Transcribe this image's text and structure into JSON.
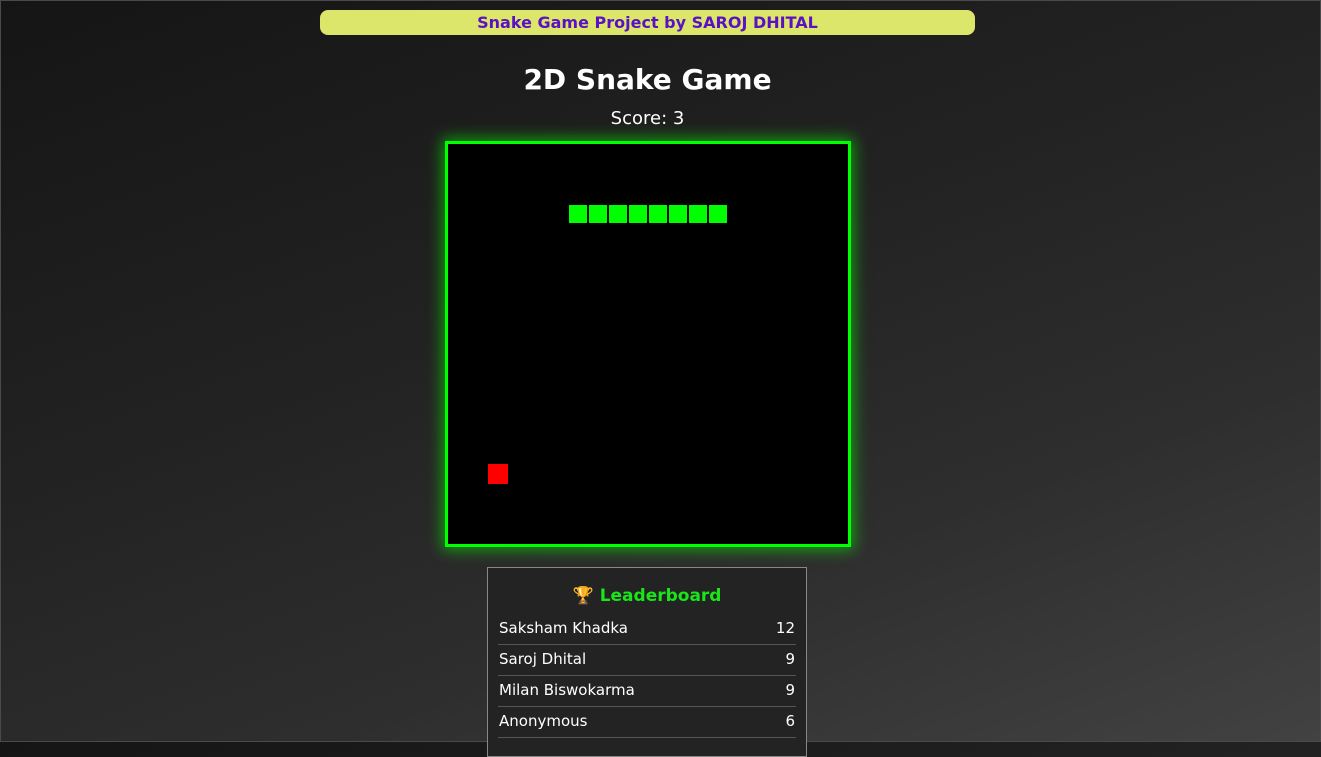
{
  "banner": {
    "text": "Snake Game Project by SAROJ DHITAL"
  },
  "game": {
    "title": "2D Snake Game",
    "score_text": "Score: 3",
    "score": 3,
    "grid": {
      "cols": 20,
      "rows": 20
    },
    "snake": [
      {
        "col": 6,
        "row": 3
      },
      {
        "col": 7,
        "row": 3
      },
      {
        "col": 8,
        "row": 3
      },
      {
        "col": 9,
        "row": 3
      },
      {
        "col": 10,
        "row": 3
      },
      {
        "col": 11,
        "row": 3
      },
      {
        "col": 12,
        "row": 3
      },
      {
        "col": 13,
        "row": 3
      }
    ],
    "food": {
      "col": 2,
      "row": 16
    }
  },
  "leaderboard": {
    "icon": "trophy-icon",
    "title": "Leaderboard",
    "entries": [
      {
        "name": "Saksham Khadka",
        "score": "12"
      },
      {
        "name": "Saroj Dhital",
        "score": "9"
      },
      {
        "name": "Milan Biswokarma",
        "score": "9"
      },
      {
        "name": "Anonymous",
        "score": "6"
      }
    ]
  },
  "colors": {
    "banner_bg": "#dbe66a",
    "banner_text": "#5a10c4",
    "snake": "#00ff00",
    "food": "#ff0000",
    "board_border": "#00ff00",
    "leaderboard_title": "#19e619"
  }
}
